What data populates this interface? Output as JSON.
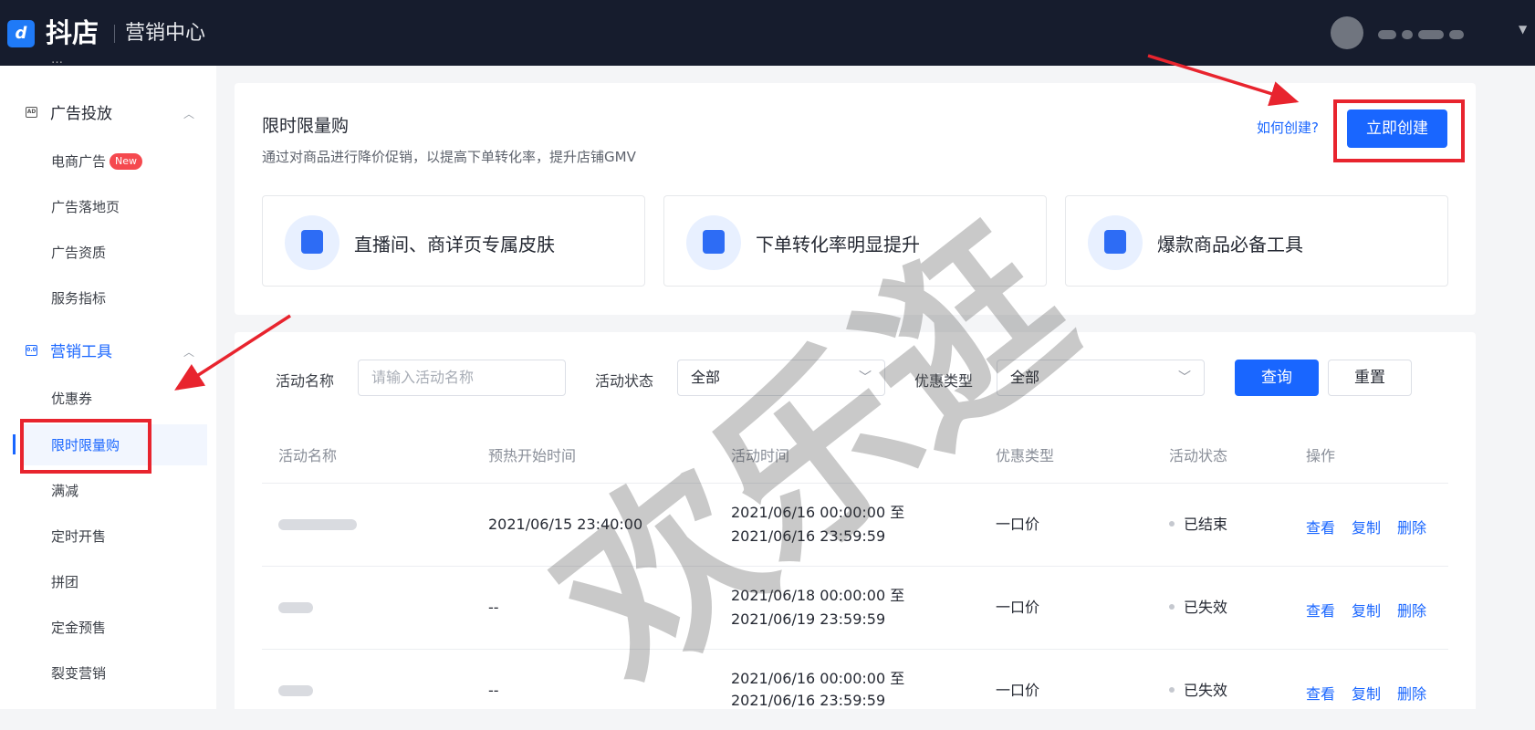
{
  "header": {
    "logo_glyph": "d",
    "brand": "抖店",
    "subtitle": "营销中心"
  },
  "sidebar": {
    "faded_item": "…",
    "groups": [
      {
        "label": "广告投放",
        "icon": "ad-icon",
        "items": [
          {
            "label": "电商广告",
            "badge": "New"
          },
          {
            "label": "广告落地页"
          },
          {
            "label": "广告资质"
          },
          {
            "label": "服务指标"
          }
        ]
      },
      {
        "label": "营销工具",
        "icon": "marketing-icon",
        "items": [
          {
            "label": "优惠券"
          },
          {
            "label": "限时限量购"
          },
          {
            "label": "满减"
          },
          {
            "label": "定时开售"
          },
          {
            "label": "拼团"
          },
          {
            "label": "定金预售"
          },
          {
            "label": "裂变营销"
          }
        ]
      }
    ]
  },
  "intro": {
    "title": "限时限量购",
    "description": "通过对商品进行降价促销，以提高下单转化率，提升店铺GMV",
    "help_link": "如何创建?",
    "create_button": "立即创建",
    "features": [
      {
        "text": "直播间、商详页专属皮肤",
        "icon": "cart-icon"
      },
      {
        "text": "下单转化率明显提升",
        "icon": "growth-chart-icon"
      },
      {
        "text": "爆款商品必备工具",
        "icon": "shopping-bag-icon"
      }
    ]
  },
  "filters": {
    "name_label": "活动名称",
    "name_placeholder": "请输入活动名称",
    "status_label": "活动状态",
    "status_value": "全部",
    "type_label": "优惠类型",
    "type_value": "全部",
    "query_button": "查询",
    "reset_button": "重置"
  },
  "table": {
    "headers": [
      "活动名称",
      "预热开始时间",
      "活动时间",
      "优惠类型",
      "活动状态",
      "操作"
    ],
    "rows": [
      {
        "preheat": "2021/06/15 23:40:00",
        "time_start": "2021/06/16 00:00:00 至",
        "time_end": "2021/06/16 23:59:59",
        "type": "一口价",
        "status": "已结束",
        "ops": [
          "查看",
          "复制",
          "删除"
        ]
      },
      {
        "preheat": "--",
        "time_start": "2021/06/18 00:00:00 至",
        "time_end": "2021/06/19 23:59:59",
        "type": "一口价",
        "status": "已失效",
        "ops": [
          "查看",
          "复制",
          "删除"
        ]
      },
      {
        "preheat": "--",
        "time_start": "2021/06/16 00:00:00 至",
        "time_end": "2021/06/16 23:59:59",
        "type": "一口价",
        "status": "已失效",
        "ops": [
          "查看",
          "复制",
          "删除"
        ]
      }
    ]
  },
  "watermark": "欢乐逛",
  "colors": {
    "primary": "#1966ff",
    "header_bg": "#161c2d",
    "annotation_red": "#e8242e",
    "badge_red": "#f5494f"
  }
}
